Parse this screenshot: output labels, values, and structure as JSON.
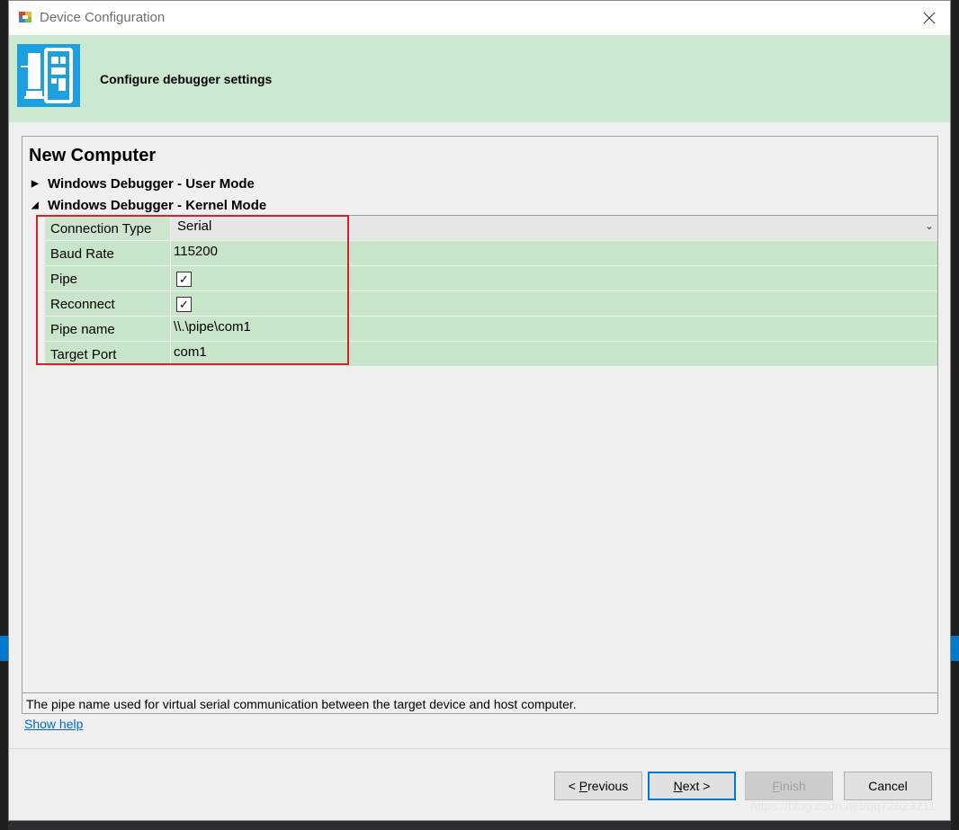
{
  "window": {
    "title": "Device Configuration"
  },
  "header": {
    "title": "Configure debugger settings"
  },
  "panel": {
    "title": "New Computer",
    "sections": [
      {
        "label": "Windows Debugger - User Mode",
        "expanded": false
      },
      {
        "label": "Windows Debugger - Kernel Mode",
        "expanded": true
      }
    ]
  },
  "properties": [
    {
      "label": "Connection Type",
      "value": "Serial",
      "type": "dropdown"
    },
    {
      "label": "Baud Rate",
      "value": "115200",
      "type": "text"
    },
    {
      "label": "Pipe",
      "checked": true,
      "type": "checkbox"
    },
    {
      "label": "Reconnect",
      "checked": true,
      "type": "checkbox"
    },
    {
      "label": "Pipe name",
      "value": "\\\\.\\pipe\\com1",
      "type": "text"
    },
    {
      "label": "Target Port",
      "value": "com1",
      "type": "text"
    }
  ],
  "description": "The pipe name used for virtual serial communication between the target device and host computer.",
  "show_help": "Show help",
  "buttons": {
    "previous": {
      "prefix": "< ",
      "mnemonic": "P",
      "rest": "revious"
    },
    "next": {
      "mnemonic": "N",
      "rest": "ext >"
    },
    "finish": {
      "mnemonic": "F",
      "rest": "inish"
    },
    "cancel": "Cancel"
  },
  "watermark": "https://blog.csdn.net/qq72623211",
  "colors": {
    "header_band": "#cde8d1",
    "property_row": "#c8e4c9",
    "highlight_box": "#d0232a",
    "primary_button_border": "#0078d7",
    "logo_blue": "#1ba1e2"
  }
}
